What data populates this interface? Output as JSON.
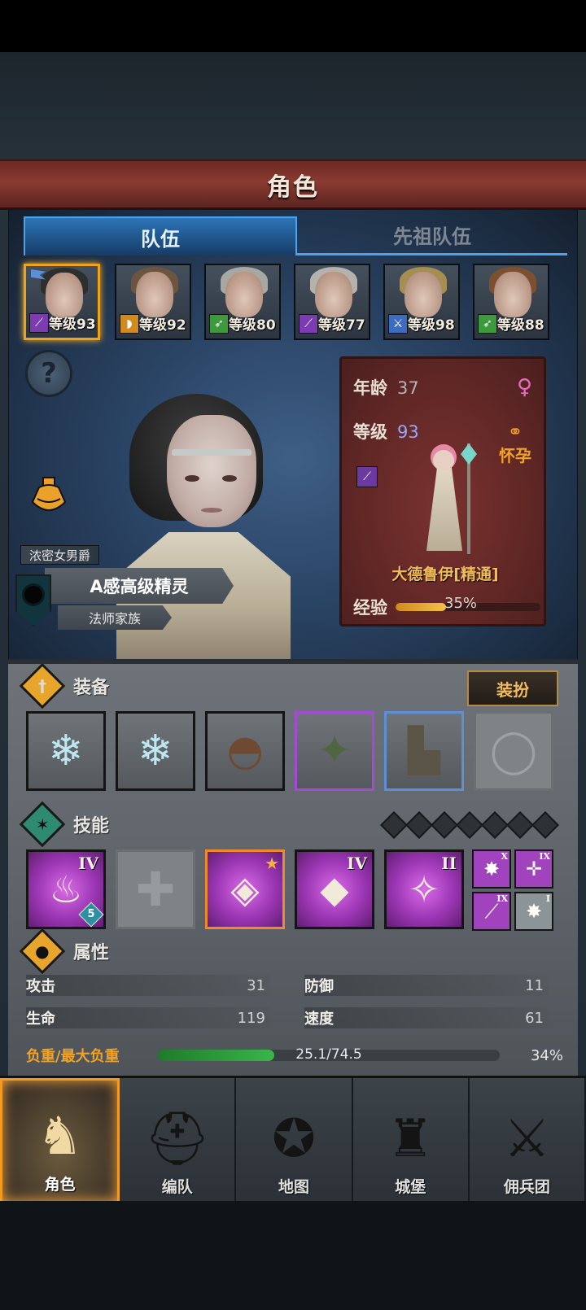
{
  "header": {
    "title": "角色"
  },
  "tabs": [
    {
      "label": "队伍",
      "active": true
    },
    {
      "label": "先祖队伍",
      "active": false
    }
  ],
  "roster": [
    {
      "level": "等级93",
      "class_icon": "staff-icon",
      "selected": true,
      "hair": "#2e2e2e",
      "badge_color": "#7a3cb0"
    },
    {
      "level": "等级92",
      "class_icon": "shield-icon",
      "selected": false,
      "hair": "#6b5440",
      "badge_color": "#d08a1d"
    },
    {
      "level": "等级80",
      "class_icon": "bow-icon",
      "selected": false,
      "hair": "#a8a8a2",
      "badge_color": "#3c9a3c"
    },
    {
      "level": "等级77",
      "class_icon": "staff-icon",
      "selected": false,
      "hair": "#b5b2ad",
      "badge_color": "#7a3cb0"
    },
    {
      "level": "等级98",
      "class_icon": "sword-icon",
      "selected": false,
      "hair": "#a58e4f",
      "badge_color": "#3b6cc2"
    },
    {
      "level": "等级88",
      "class_icon": "bow-icon",
      "selected": false,
      "hair": "#7a5030",
      "badge_color": "#3c9a3c"
    }
  ],
  "character": {
    "title": "浓密女男爵",
    "name": "A感高级精灵",
    "family": "法师家族",
    "age_label": "年龄",
    "age": "37",
    "level_label": "等级",
    "level": "93",
    "status": "怀孕",
    "class_name": "大德鲁伊[精通]",
    "exp_label": "经验",
    "exp_pct": "35%",
    "exp_fraction": 0.35
  },
  "sections": {
    "equipment": "装备",
    "dress_button": "装扮",
    "skills": "技能",
    "attributes": "属性"
  },
  "equipment": [
    {
      "icon": "crystal-staff-icon",
      "glyph": "❄",
      "rarity": "normal"
    },
    {
      "icon": "crystal-staff-icon",
      "glyph": "❄",
      "rarity": "normal"
    },
    {
      "icon": "hood-icon",
      "glyph": "◓",
      "rarity": "normal"
    },
    {
      "icon": "fur-cloak-icon",
      "glyph": "✦",
      "rarity": "purple"
    },
    {
      "icon": "boots-icon",
      "glyph": "▙",
      "rarity": "blue"
    },
    {
      "icon": "ring-slot-icon",
      "glyph": "◯",
      "rarity": "empty"
    }
  ],
  "skills": [
    {
      "icon": "fire-icon",
      "glyph": "♨",
      "rank": "IV",
      "badge": "5"
    },
    {
      "icon": "empty-skill-slot-icon",
      "glyph": "✚",
      "rank": ""
    },
    {
      "icon": "tornado-crystal-icon",
      "glyph": "◈",
      "star": true
    },
    {
      "icon": "crystal-arm-icon",
      "glyph": "◆",
      "rank": "IV"
    },
    {
      "icon": "holy-spear-icon",
      "glyph": "✧",
      "rank": "II"
    }
  ],
  "mini_skills": [
    {
      "icon": "burst-icon",
      "glyph": "✸",
      "rank": "X"
    },
    {
      "icon": "target-icon",
      "glyph": "✛",
      "rank": "IX"
    },
    {
      "icon": "wand-icon",
      "glyph": "⟋",
      "rank": "IX"
    },
    {
      "icon": "burst-icon",
      "glyph": "✸",
      "rank": "I"
    }
  ],
  "stats": {
    "attack_label": "攻击",
    "attack": "31",
    "defense_label": "防御",
    "defense": "11",
    "hp_label": "生命",
    "hp": "119",
    "speed_label": "速度",
    "speed": "61",
    "load_label": "负重/最大负重",
    "load_value": "25.1/74.5",
    "load_pct": "34%",
    "load_fraction": 0.34
  },
  "nav": [
    {
      "label": "角色",
      "icon": "knight-icon",
      "glyph": "♞",
      "active": true
    },
    {
      "label": "编队",
      "icon": "helmet-icon",
      "glyph": "⛑",
      "active": false
    },
    {
      "label": "地图",
      "icon": "compass-map-icon",
      "glyph": "✪",
      "active": false
    },
    {
      "label": "城堡",
      "icon": "castle-icon",
      "glyph": "♜",
      "active": false
    },
    {
      "label": "佣兵团",
      "icon": "mercenary-icon",
      "glyph": "⚔",
      "active": false
    }
  ]
}
